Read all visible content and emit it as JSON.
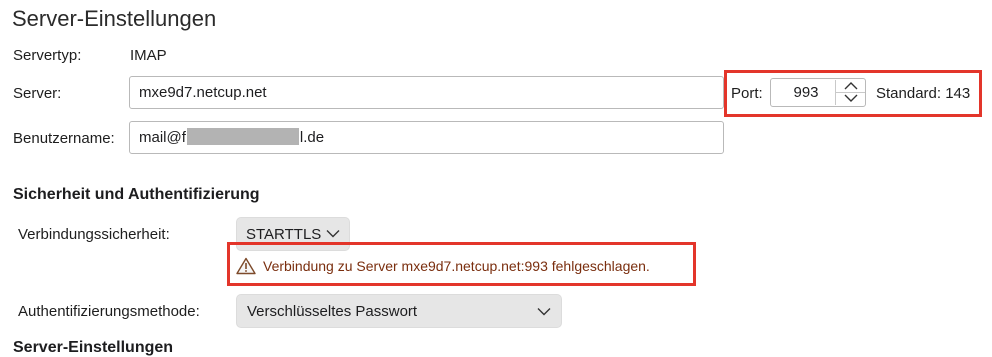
{
  "page": {
    "title": "Server-Einstellungen"
  },
  "server_settings": {
    "servertype_label": "Servertyp:",
    "servertype_value": "IMAP",
    "server_label": "Server:",
    "server_value": "mxe9d7.netcup.net",
    "port_label": "Port:",
    "port_value": "993",
    "port_default": "Standard: 143",
    "username_label": "Benutzername:",
    "username_prefix": "mail@f",
    "username_suffix": "l.de"
  },
  "security": {
    "heading": "Sicherheit und Authentifizierung",
    "connection_label": "Verbindungssicherheit:",
    "connection_value": "STARTTLS",
    "error_message": "Verbindung zu Server mxe9d7.netcup.net:993 fehlgeschlagen.",
    "auth_label": "Authentifizierungsmethode:",
    "auth_value": "Verschlüsseltes Passwort"
  },
  "next_section": {
    "heading": "Server-Einstellungen"
  },
  "icons": {
    "warning": "warning-icon",
    "stepper_up": "chevron-up-icon",
    "stepper_down": "chevron-down-icon",
    "popup": "chevron-down-icon"
  },
  "colors": {
    "highlight": "#e3352a",
    "error_text": "#7a2e0e"
  }
}
